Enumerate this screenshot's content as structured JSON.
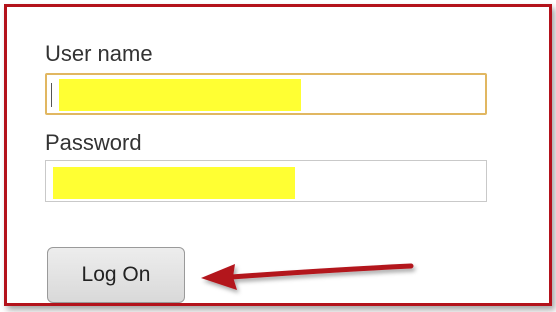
{
  "form": {
    "username_label": "User name",
    "username_value": "",
    "password_label": "Password",
    "password_value": "",
    "logon_label": "Log On"
  },
  "colors": {
    "frame_border": "#b3121b",
    "focus_border": "#e1b761",
    "redaction": "#ffff33",
    "arrow": "#b3121b"
  },
  "icons": {
    "arrow": "red-arrow-pointing-left"
  }
}
